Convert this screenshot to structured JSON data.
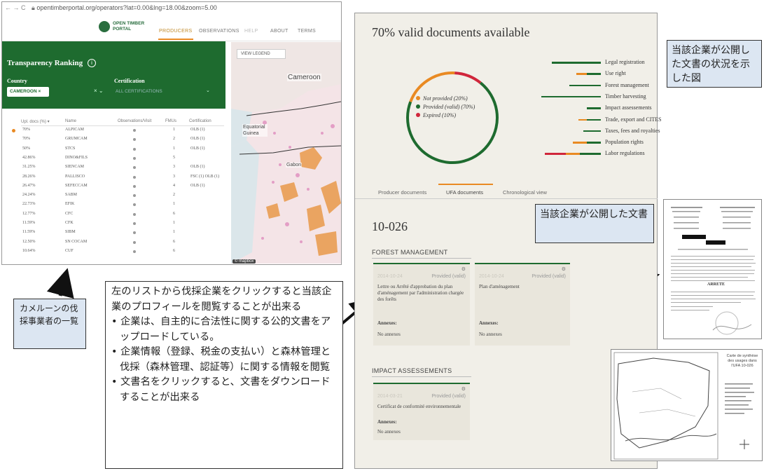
{
  "browser": {
    "url": "opentimberportal.org/operators?lat=0.00&lng=18.00&zoom=5.00",
    "nav": {
      "logo_line1": "OPEN TIMBER",
      "logo_line2": "PORTAL",
      "items": [
        {
          "label": "PRODUCERS",
          "active": true
        },
        {
          "label": "OBSERVATIONS",
          "active": false
        },
        {
          "label": "HELP",
          "active": false
        },
        {
          "label": "ABOUT",
          "active": false
        },
        {
          "label": "TERMS",
          "active": false
        }
      ]
    },
    "ranking": {
      "title": "Transparency Ranking",
      "info": "i",
      "country_label": "Country",
      "certification_label": "Certification",
      "country_value": "CAMEROON ×",
      "country_clear": "× ⌄",
      "certification_placeholder": "ALL CERTIFICATIONS",
      "certification_chevron": "⌄",
      "columns": [
        "Upl. docs (%) ▾",
        "Name",
        "Observations/Visit",
        "FMUs",
        "Certification"
      ],
      "rows": [
        {
          "pct": "70%",
          "name": "ALPICAM",
          "fmus": "1",
          "cert": "OLB (1)"
        },
        {
          "pct": "70%",
          "name": "GRUMCAM",
          "fmus": "2",
          "cert": "OLB (1)"
        },
        {
          "pct": "50%",
          "name": "STCS",
          "fmus": "1",
          "cert": "OLB (1)"
        },
        {
          "pct": "42.86%",
          "name": "DINO&FILS",
          "fmus": "5",
          "cert": ""
        },
        {
          "pct": "31.25%",
          "name": "SIENCAM",
          "fmus": "3",
          "cert": "OLB (1)"
        },
        {
          "pct": "28.26%",
          "name": "PALLISCO",
          "fmus": "3",
          "cert": "FSC (1) OLB (1)"
        },
        {
          "pct": "26.47%",
          "name": "SEFECCAM",
          "fmus": "4",
          "cert": "OLB (1)"
        },
        {
          "pct": "24.24%",
          "name": "SABM",
          "fmus": "2",
          "cert": ""
        },
        {
          "pct": "22.73%",
          "name": "EFIK",
          "fmus": "1",
          "cert": ""
        },
        {
          "pct": "12.77%",
          "name": "CFC",
          "fmus": "6",
          "cert": ""
        },
        {
          "pct": "11.59%",
          "name": "CFK",
          "fmus": "1",
          "cert": ""
        },
        {
          "pct": "11.59%",
          "name": "SIBM",
          "fmus": "1",
          "cert": ""
        },
        {
          "pct": "12.50%",
          "name": "SN COCAM",
          "fmus": "6",
          "cert": ""
        },
        {
          "pct": "10.64%",
          "name": "CUF",
          "fmus": "6",
          "cert": ""
        }
      ]
    },
    "map": {
      "legend_button": "VIEW LEGEND",
      "labels": {
        "cameroon": "Cameroon",
        "eq_guinea": "Equatorial Guinea",
        "gabon": "Gabon"
      },
      "footer": "© mapbox"
    }
  },
  "callouts": {
    "list": "カメルーンの伐採事業者の一覧",
    "main_intro": "左のリストから伐採企業をクリックすると当該企業のプロフィールを閲覧することが出来る",
    "main_bullets": [
      "企業は、自主的に合法性に関する公的文書をアップロードしている。",
      "企業情報（登録、税金の支払い）と森林管理と伐採（森林管理、認証等）に関する情報を閲覧",
      "文書名をクリックすると、文書をダウンロードすることが出来る"
    ],
    "status_figure": "当該企業が公開した文書の状況を示した図",
    "published_docs": "当該企業が公開した文書"
  },
  "ufa": {
    "title": "70% valid documents available",
    "donut_legend": [
      {
        "label": "Not provided (20%)",
        "color": "#e98a23",
        "value": 20
      },
      {
        "label": "Provided (valid) (70%)",
        "color": "#1e6b2f",
        "value": 70
      },
      {
        "label": "Expired (10%)",
        "color": "#d0263b",
        "value": 10
      }
    ],
    "categories": [
      "Legal registration",
      "Use right",
      "Forest management",
      "Timber harvesting",
      "Impact assessements",
      "Trade, export and CITES",
      "Taxes, fees and royalties",
      "Population rights",
      "Labor regulations"
    ],
    "tabs": [
      "Producer documents",
      "UFA documents",
      "Chronological view"
    ],
    "active_tab": "UFA documents",
    "code": "10-026",
    "sections": {
      "forest_management": {
        "heading": "FOREST MANAGEMENT",
        "cards": [
          {
            "date": "2014-10-24",
            "status": "Provided (valid)",
            "name": "Lettre ou Arrêté d'approbation du plan d'aménagement par l'administration chargée des forêts",
            "annexes_label": "Annexes:",
            "annexes_value": "No annexes"
          },
          {
            "date": "2014-10-24",
            "status": "Provided (valid)",
            "name": "Plan d'aménagement",
            "annexes_label": "Annexes:",
            "annexes_value": "No annexes"
          }
        ]
      },
      "impact_assessments": {
        "heading": "IMPACT ASSESSEMENTS",
        "cards": [
          {
            "date": "2014-03-21",
            "status": "Provided (valid)",
            "name": "Certificat de conformité environnementale",
            "annexes_label": "Annexes:",
            "annexes_value": "No annexes"
          }
        ]
      }
    }
  },
  "documents": {
    "doc1_title": "ARRETE",
    "doc2_title": "Carte de synthèse des usages dans l'UFA 10-026"
  },
  "colors": {
    "green": "#1e6b2f",
    "orange": "#e98a23",
    "red": "#d0263b",
    "callout": "#dce6f2"
  }
}
